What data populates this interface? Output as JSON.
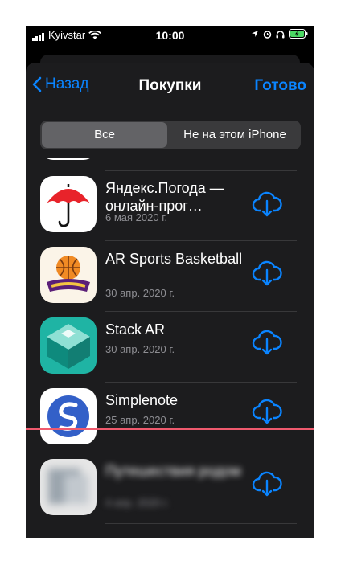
{
  "status_bar": {
    "carrier": "Kyivstar",
    "time": "10:00"
  },
  "nav": {
    "back_label": "Назад",
    "title": "Покупки",
    "done_label": "Готово"
  },
  "segmented": {
    "all_label": "Все",
    "not_on_device_label": "Не на этом iPhone"
  },
  "apps": [
    {
      "name": "Яндекс.Погода — онлайн-прог…",
      "date": "6 мая 2020 г."
    },
    {
      "name": "AR Sports Basketball",
      "date": "30 апр. 2020 г."
    },
    {
      "name": "Stack AR",
      "date": "30 апр. 2020 г."
    },
    {
      "name": "Simplenote",
      "date": "25 апр. 2020 г."
    },
    {
      "name": "Путешествия родом",
      "date": "4 апр. 2020 г."
    }
  ],
  "icons": {
    "download": "cloud-download-icon",
    "back": "chevron-left-icon"
  },
  "colors": {
    "accent": "#0a84ff",
    "background": "#1c1c1e",
    "marker": "#ef5a6e"
  }
}
